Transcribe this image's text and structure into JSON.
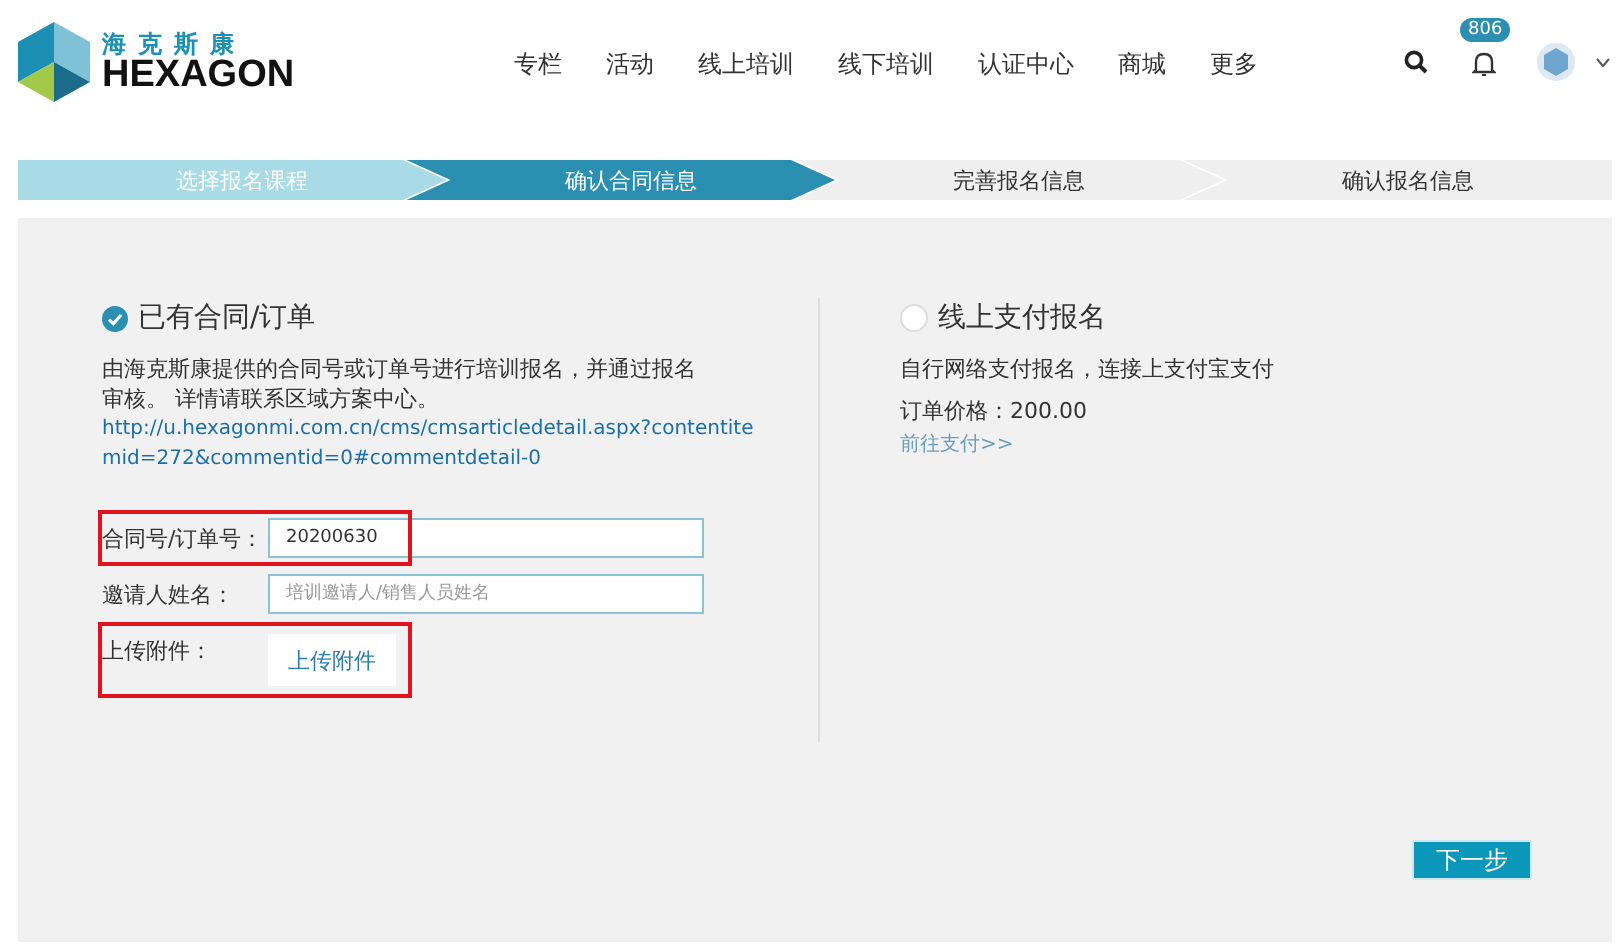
{
  "logo": {
    "chinese": "海克斯康",
    "name": "HEXAGON"
  },
  "nav": [
    "专栏",
    "活动",
    "线上培训",
    "线下培训",
    "认证中心",
    "商城",
    "更多"
  ],
  "notifications": {
    "count": "806"
  },
  "steps": [
    {
      "label": "选择报名课程",
      "selected": false,
      "completed": true
    },
    {
      "label": "确认合同信息",
      "selected": true,
      "completed": false
    },
    {
      "label": "完善报名信息",
      "selected": false,
      "completed": false
    },
    {
      "label": "确认报名信息",
      "selected": false,
      "completed": false
    }
  ],
  "options": [
    {
      "title": "已有合同/订单",
      "selected": true,
      "description": "由海克斯康提供的合同号或订单号进行培训报名，并通过报名审核。 详情请联系区域方案中心。",
      "link": "http://u.hexagonmi.com.cn/cms/cmsarticledetail.aspx?contentitemid=272&commentid=0#commentdetail-0",
      "fields": [
        {
          "kind": "input",
          "label": "合同号/订单号：",
          "value": "20200630",
          "highlighted": true
        },
        {
          "kind": "input",
          "label": "邀请人姓名：",
          "placeholder": "培训邀请人/销售人员姓名",
          "highlighted": false
        },
        {
          "kind": "upload",
          "label": "上传附件：",
          "button": "上传附件",
          "highlighted": true
        }
      ]
    },
    {
      "title": "线上支付报名",
      "selected": false,
      "description": "自行网络支付报名，连接上支付宝支付",
      "price": "订单价格：200.00",
      "link_text": "前往支付>>"
    }
  ],
  "next_button": "下一步"
}
